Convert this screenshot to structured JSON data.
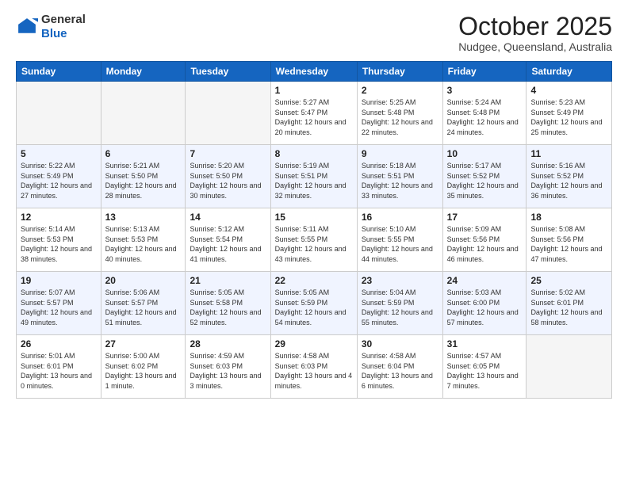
{
  "header": {
    "logo_general": "General",
    "logo_blue": "Blue",
    "title": "October 2025",
    "subtitle": "Nudgee, Queensland, Australia"
  },
  "days_of_week": [
    "Sunday",
    "Monday",
    "Tuesday",
    "Wednesday",
    "Thursday",
    "Friday",
    "Saturday"
  ],
  "weeks": [
    [
      {
        "day": "",
        "info": ""
      },
      {
        "day": "",
        "info": ""
      },
      {
        "day": "",
        "info": ""
      },
      {
        "day": "1",
        "info": "Sunrise: 5:27 AM\nSunset: 5:47 PM\nDaylight: 12 hours\nand 20 minutes."
      },
      {
        "day": "2",
        "info": "Sunrise: 5:25 AM\nSunset: 5:48 PM\nDaylight: 12 hours\nand 22 minutes."
      },
      {
        "day": "3",
        "info": "Sunrise: 5:24 AM\nSunset: 5:48 PM\nDaylight: 12 hours\nand 24 minutes."
      },
      {
        "day": "4",
        "info": "Sunrise: 5:23 AM\nSunset: 5:49 PM\nDaylight: 12 hours\nand 25 minutes."
      }
    ],
    [
      {
        "day": "5",
        "info": "Sunrise: 5:22 AM\nSunset: 5:49 PM\nDaylight: 12 hours\nand 27 minutes."
      },
      {
        "day": "6",
        "info": "Sunrise: 5:21 AM\nSunset: 5:50 PM\nDaylight: 12 hours\nand 28 minutes."
      },
      {
        "day": "7",
        "info": "Sunrise: 5:20 AM\nSunset: 5:50 PM\nDaylight: 12 hours\nand 30 minutes."
      },
      {
        "day": "8",
        "info": "Sunrise: 5:19 AM\nSunset: 5:51 PM\nDaylight: 12 hours\nand 32 minutes."
      },
      {
        "day": "9",
        "info": "Sunrise: 5:18 AM\nSunset: 5:51 PM\nDaylight: 12 hours\nand 33 minutes."
      },
      {
        "day": "10",
        "info": "Sunrise: 5:17 AM\nSunset: 5:52 PM\nDaylight: 12 hours\nand 35 minutes."
      },
      {
        "day": "11",
        "info": "Sunrise: 5:16 AM\nSunset: 5:52 PM\nDaylight: 12 hours\nand 36 minutes."
      }
    ],
    [
      {
        "day": "12",
        "info": "Sunrise: 5:14 AM\nSunset: 5:53 PM\nDaylight: 12 hours\nand 38 minutes."
      },
      {
        "day": "13",
        "info": "Sunrise: 5:13 AM\nSunset: 5:53 PM\nDaylight: 12 hours\nand 40 minutes."
      },
      {
        "day": "14",
        "info": "Sunrise: 5:12 AM\nSunset: 5:54 PM\nDaylight: 12 hours\nand 41 minutes."
      },
      {
        "day": "15",
        "info": "Sunrise: 5:11 AM\nSunset: 5:55 PM\nDaylight: 12 hours\nand 43 minutes."
      },
      {
        "day": "16",
        "info": "Sunrise: 5:10 AM\nSunset: 5:55 PM\nDaylight: 12 hours\nand 44 minutes."
      },
      {
        "day": "17",
        "info": "Sunrise: 5:09 AM\nSunset: 5:56 PM\nDaylight: 12 hours\nand 46 minutes."
      },
      {
        "day": "18",
        "info": "Sunrise: 5:08 AM\nSunset: 5:56 PM\nDaylight: 12 hours\nand 47 minutes."
      }
    ],
    [
      {
        "day": "19",
        "info": "Sunrise: 5:07 AM\nSunset: 5:57 PM\nDaylight: 12 hours\nand 49 minutes."
      },
      {
        "day": "20",
        "info": "Sunrise: 5:06 AM\nSunset: 5:57 PM\nDaylight: 12 hours\nand 51 minutes."
      },
      {
        "day": "21",
        "info": "Sunrise: 5:05 AM\nSunset: 5:58 PM\nDaylight: 12 hours\nand 52 minutes."
      },
      {
        "day": "22",
        "info": "Sunrise: 5:05 AM\nSunset: 5:59 PM\nDaylight: 12 hours\nand 54 minutes."
      },
      {
        "day": "23",
        "info": "Sunrise: 5:04 AM\nSunset: 5:59 PM\nDaylight: 12 hours\nand 55 minutes."
      },
      {
        "day": "24",
        "info": "Sunrise: 5:03 AM\nSunset: 6:00 PM\nDaylight: 12 hours\nand 57 minutes."
      },
      {
        "day": "25",
        "info": "Sunrise: 5:02 AM\nSunset: 6:01 PM\nDaylight: 12 hours\nand 58 minutes."
      }
    ],
    [
      {
        "day": "26",
        "info": "Sunrise: 5:01 AM\nSunset: 6:01 PM\nDaylight: 13 hours\nand 0 minutes."
      },
      {
        "day": "27",
        "info": "Sunrise: 5:00 AM\nSunset: 6:02 PM\nDaylight: 13 hours\nand 1 minute."
      },
      {
        "day": "28",
        "info": "Sunrise: 4:59 AM\nSunset: 6:03 PM\nDaylight: 13 hours\nand 3 minutes."
      },
      {
        "day": "29",
        "info": "Sunrise: 4:58 AM\nSunset: 6:03 PM\nDaylight: 13 hours\nand 4 minutes."
      },
      {
        "day": "30",
        "info": "Sunrise: 4:58 AM\nSunset: 6:04 PM\nDaylight: 13 hours\nand 6 minutes."
      },
      {
        "day": "31",
        "info": "Sunrise: 4:57 AM\nSunset: 6:05 PM\nDaylight: 13 hours\nand 7 minutes."
      },
      {
        "day": "",
        "info": ""
      }
    ]
  ]
}
